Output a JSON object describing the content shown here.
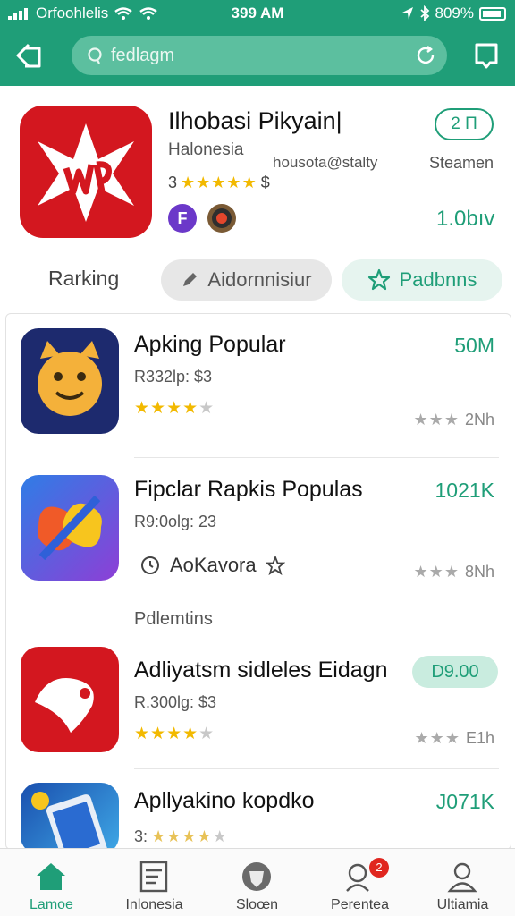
{
  "status_bar": {
    "carrier": "Orfoohlelis",
    "time": "399 AM",
    "battery": "809%"
  },
  "header": {
    "search_placeholder": "fedlagm"
  },
  "featured": {
    "title": "Ilhobasi Pikyain|",
    "subtitle": "Halonesia",
    "email": "housota@stalty",
    "install_label": "2 П",
    "steam_label": "Steamen",
    "rating_prefix": "3",
    "rating_suffix": "$",
    "chip_label": "F",
    "size": "1.0bıv",
    "colors": {
      "icon_bg": "#d3171f",
      "accent": "#1f9e78"
    }
  },
  "tabs": {
    "ranking": "Rarking",
    "admin": "Aidornnisiur",
    "padbnns": "Padbnns"
  },
  "apps": [
    {
      "name": "Apking Popular",
      "meta": "R332lp: $3",
      "size": "50M",
      "stars": 4,
      "count": "2Nh",
      "icon": "cat-emoji-icon"
    },
    {
      "name": "Fipclar Rapkis Populas",
      "meta": "R9:0olg: 23",
      "size": "1021K",
      "developer": "AoKavora",
      "count": "8Nh",
      "icon": "swirl-logo-icon"
    },
    {
      "name": "Adliyatsm sidleles Eidagn",
      "meta": "R.300lg: $3",
      "price": "D9.00",
      "stars": 4,
      "count": "E1h",
      "icon": "heart-pin-icon"
    },
    {
      "name": "Apllyakino kopdko",
      "meta": "3:",
      "size": "J071K",
      "stars": 3,
      "icon": "phone-app-icon"
    }
  ],
  "section_label": "Pdlemtins",
  "bottom_nav": [
    {
      "label": "Lamoe",
      "icon": "home-icon",
      "active": true
    },
    {
      "label": "Inlonesia",
      "icon": "document-icon"
    },
    {
      "label": "Sloœn",
      "icon": "shield-icon"
    },
    {
      "label": "Perentea",
      "icon": "search-user-icon",
      "badge": "2"
    },
    {
      "label": "Ultiamia",
      "icon": "profile-icon"
    }
  ]
}
